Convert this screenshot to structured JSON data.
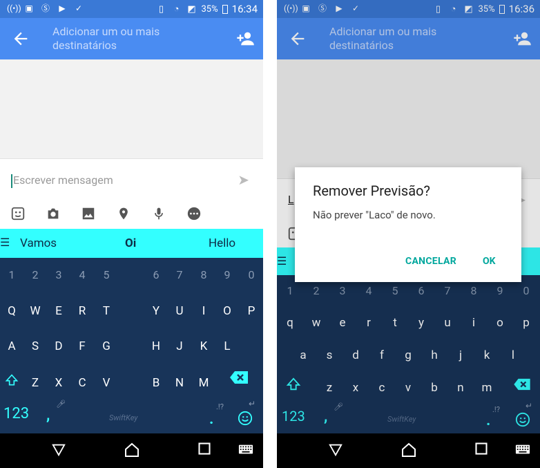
{
  "screens": [
    {
      "status": {
        "battery": "35%",
        "time": "16:34"
      },
      "toolbar": {
        "recipient_placeholder": "Adicionar um ou mais destinatários"
      },
      "compose": {
        "placeholder": "Escrever mensagem"
      },
      "suggestions": [
        "Vamos",
        "Oi",
        "Hello"
      ],
      "keyboard": {
        "numbers": [
          "1",
          "2",
          "3",
          "4",
          "5",
          "6",
          "7",
          "8",
          "9",
          "0"
        ],
        "row1": [
          "Q",
          "W",
          "E",
          "R",
          "T",
          "Y",
          "U",
          "I",
          "O",
          "P"
        ],
        "row2": [
          "A",
          "S",
          "D",
          "F",
          "G",
          "H",
          "J",
          "K",
          "L"
        ],
        "row3": [
          "Z",
          "X",
          "C",
          "V",
          "B",
          "N",
          "M"
        ],
        "fn_label": "123",
        "comma": ",",
        "brand": "SwiftKey",
        "punct_hint": ".!?",
        "period": "."
      }
    },
    {
      "status": {
        "battery": "35%",
        "time": "16:36"
      },
      "toolbar": {
        "recipient_placeholder": "Adicionar um ou mais destinatários"
      },
      "compose": {
        "placeholder": "L"
      },
      "keyboard": {
        "numbers": [
          "1",
          "2",
          "3",
          "4",
          "5",
          "6",
          "7",
          "8",
          "9",
          "0"
        ],
        "row1": [
          "q",
          "w",
          "e",
          "r",
          "t",
          "y",
          "u",
          "i",
          "o",
          "p"
        ],
        "row2": [
          "a",
          "s",
          "d",
          "f",
          "g",
          "h",
          "j",
          "k",
          "l"
        ],
        "row3": [
          "z",
          "x",
          "c",
          "v",
          "b",
          "n",
          "m"
        ],
        "fn_label": "123",
        "comma": ",",
        "brand": "SwiftKey",
        "punct_hint": ".!?",
        "period": "."
      },
      "dialog": {
        "title": "Remover Previsão?",
        "message": "Não prever \"Laco\" de novo.",
        "cancel": "CANCELAR",
        "ok": "OK"
      }
    }
  ],
  "colors": {
    "statusbar": "#3a79d6",
    "toolbar": "#4a8cf2",
    "suggestion_bar": "#33ffff",
    "keyboard": "#183459",
    "accent": "#00a79d"
  },
  "icons": [
    "signal-icon",
    "image-icon",
    "sf-icon",
    "video-icon",
    "clipboard-icon",
    "vibrate-icon",
    "wifi-icon",
    "no-sim-icon",
    "back-arrow-icon",
    "add-person-icon",
    "send-icon",
    "sticker-icon",
    "camera-icon",
    "gallery-icon",
    "location-icon",
    "mic-icon",
    "more-icon",
    "shift-icon",
    "backspace-icon",
    "emoji-icon",
    "nav-back-icon",
    "nav-home-icon",
    "nav-recents-icon",
    "keyboard-switch-icon"
  ]
}
